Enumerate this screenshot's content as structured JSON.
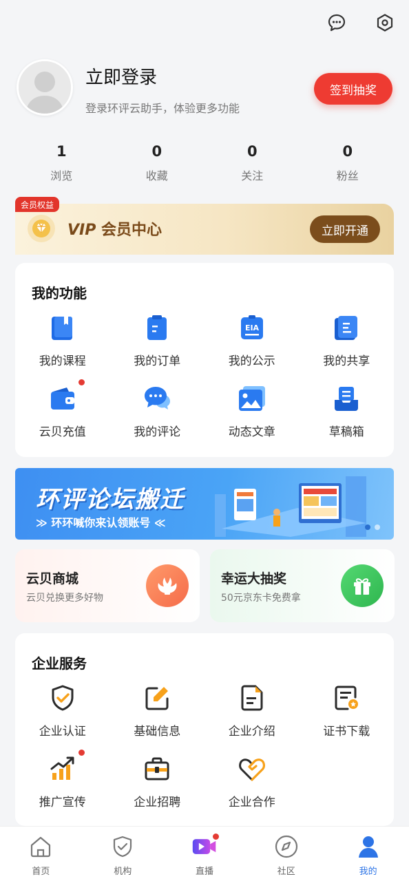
{
  "header": {
    "icons": [
      "message-icon",
      "settings-icon"
    ]
  },
  "profile": {
    "login_title": "立即登录",
    "login_subtitle": "登录环评云助手，体验更多功能",
    "checkin_label": "签到抽奖"
  },
  "stats": [
    {
      "num": "1",
      "label": "浏览"
    },
    {
      "num": "0",
      "label": "收藏"
    },
    {
      "num": "0",
      "label": "关注"
    },
    {
      "num": "0",
      "label": "粉丝"
    }
  ],
  "vip": {
    "badge": "会员权益",
    "title_vip": "VIP",
    "title_rest": "会员中心",
    "button": "立即开通"
  },
  "my_functions": {
    "title": "我的功能",
    "items": [
      {
        "label": "我的课程",
        "icon": "book-icon"
      },
      {
        "label": "我的订单",
        "icon": "clipboard-icon"
      },
      {
        "label": "我的公示",
        "icon": "eia-icon"
      },
      {
        "label": "我的共享",
        "icon": "share-doc-icon"
      },
      {
        "label": "云贝充值",
        "icon": "wallet-icon"
      },
      {
        "label": "我的评论",
        "icon": "comment-icon"
      },
      {
        "label": "动态文章",
        "icon": "image-icon"
      },
      {
        "label": "草稿箱",
        "icon": "drafts-icon"
      }
    ]
  },
  "banner": {
    "title": "环评论坛搬迁",
    "subtitle": "≫ 环环喊你来认领账号 ≪"
  },
  "promos": [
    {
      "title": "云贝商城",
      "subtitle": "云贝兑换更多好物",
      "icon": "shell-icon",
      "color": "#f7865a"
    },
    {
      "title": "幸运大抽奖",
      "subtitle": "50元京东卡免费拿",
      "icon": "gift-icon",
      "color": "#3cc45c"
    }
  ],
  "enterprise": {
    "title": "企业服务",
    "items": [
      {
        "label": "企业认证",
        "icon": "shield-check-icon"
      },
      {
        "label": "基础信息",
        "icon": "edit-icon"
      },
      {
        "label": "企业介绍",
        "icon": "document-icon"
      },
      {
        "label": "证书下载",
        "icon": "certificate-icon"
      },
      {
        "label": "推广宣传",
        "icon": "growth-chart-icon"
      },
      {
        "label": "企业招聘",
        "icon": "briefcase-icon"
      },
      {
        "label": "企业合作",
        "icon": "handshake-heart-icon"
      }
    ]
  },
  "tabbar": [
    {
      "label": "首页",
      "icon": "home-icon"
    },
    {
      "label": "机构",
      "icon": "shield-icon"
    },
    {
      "label": "直播",
      "icon": "live-video-icon"
    },
    {
      "label": "社区",
      "icon": "compass-icon"
    },
    {
      "label": "我的",
      "icon": "person-icon"
    }
  ],
  "colors": {
    "accent_blue": "#2d74e6",
    "red": "#ee3b32",
    "orange": "#f7a11a",
    "vip_brown": "#7b4d1c"
  }
}
